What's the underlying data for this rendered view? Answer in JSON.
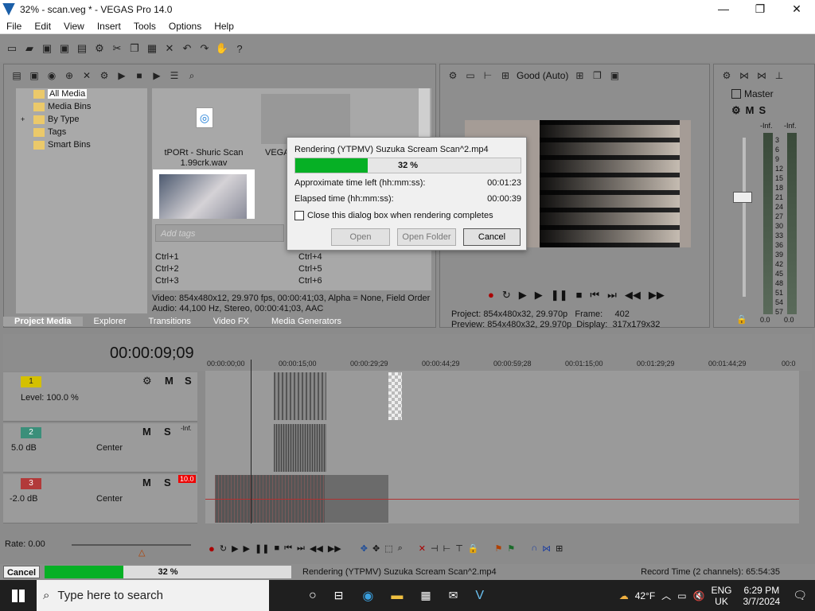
{
  "window": {
    "title": "32% - scan.veg * - VEGAS Pro 14.0",
    "min": "—",
    "max": "❐",
    "close": "✕"
  },
  "menu": [
    "File",
    "Edit",
    "View",
    "Insert",
    "Tools",
    "Options",
    "Help"
  ],
  "media": {
    "tree": [
      "All Media",
      "Media Bins",
      "By Type",
      "Tags",
      "Smart Bins"
    ],
    "file1_name": "tPORt - Shuric Scan 1.99crk.wav",
    "file2_name": "VEGA",
    "tags_placeholder": "Add tags",
    "shortcuts": [
      "Ctrl+1",
      "Ctrl+4",
      "Ctrl+2",
      "Ctrl+5",
      "Ctrl+3",
      "Ctrl+6"
    ],
    "video_info": "Video: 854x480x12, 29.970 fps, 00:00:41;03, Alpha = None, Field Order",
    "audio_info": "Audio: 44,100 Hz, Stereo, 00:00:41;03, AAC"
  },
  "tabs": [
    "Project Media",
    "Explorer",
    "Transitions",
    "Video FX",
    "Media Generators"
  ],
  "preview": {
    "quality": "Good (Auto)",
    "project_label": "Project:",
    "project_value": "854x480x32, 29.970p",
    "frame_label": "Frame:",
    "frame_value": "402",
    "preview_label": "Preview:",
    "preview_value": "854x480x32, 29.970p",
    "display_label": "Display:",
    "display_value": "317x179x32"
  },
  "master": {
    "title": "Master",
    "inf_left": "-Inf.",
    "inf_right": "-Inf.",
    "scale": [
      "3",
      "6",
      "9",
      "12",
      "15",
      "18",
      "21",
      "24",
      "27",
      "30",
      "33",
      "36",
      "39",
      "42",
      "45",
      "48",
      "51",
      "54",
      "57"
    ],
    "val_left": "0.0",
    "val_right": "0.0"
  },
  "dialog": {
    "title": "Rendering (YTPMV) Suzuka Scream Scan^2.mp4",
    "progress_text": "32 %",
    "progress": 0.32,
    "left_label": "Approximate time left (hh:mm:ss):",
    "left_value": "00:01:23",
    "elapsed_label": "Elapsed time (hh:mm:ss):",
    "elapsed_value": "00:00:39",
    "checkbox": "Close this dialog box when rendering completes",
    "open": "Open",
    "open_folder": "Open Folder",
    "cancel": "Cancel"
  },
  "timeline": {
    "timecode": "00:00:09;09",
    "ruler": [
      "00:00:00;00",
      "00:00:15;00",
      "00:00:29;29",
      "00:00:44;29",
      "00:00:59;28",
      "00:01:15;00",
      "00:01:29;29",
      "00:01:44;29",
      "00:0"
    ],
    "track1": {
      "num": "1",
      "level": "Level: 100.0 %",
      "m": "M",
      "s": "S"
    },
    "track2": {
      "num": "2",
      "db": "5.0 dB",
      "pan": "Center",
      "m": "M",
      "s": "S",
      "inf": "-Inf."
    },
    "track3": {
      "num": "3",
      "db": "-2.0 dB",
      "pan": "Center",
      "m": "M",
      "s": "S",
      "peak": "10.0"
    },
    "meter_scale": [
      "12",
      "24",
      "36",
      "48"
    ],
    "rate": "Rate: 0.00"
  },
  "status": {
    "cancel": "Cancel",
    "progress_text": "32 %",
    "progress": 0.32,
    "message": "Rendering (YTPMV) Suzuka Scream Scan^2.mp4",
    "record_time": "Record Time (2 channels): 65:54:35"
  },
  "taskbar": {
    "search_placeholder": "Type here to search",
    "weather": "42°F",
    "lang1": "ENG",
    "lang2": "UK",
    "time": "6:29 PM",
    "date": "3/7/2024",
    "notif": "1"
  },
  "colors": {
    "progress_green": "#06b025",
    "track1": "#d4c000",
    "track2": "#3b8f7a",
    "track3": "#b23a3a"
  }
}
